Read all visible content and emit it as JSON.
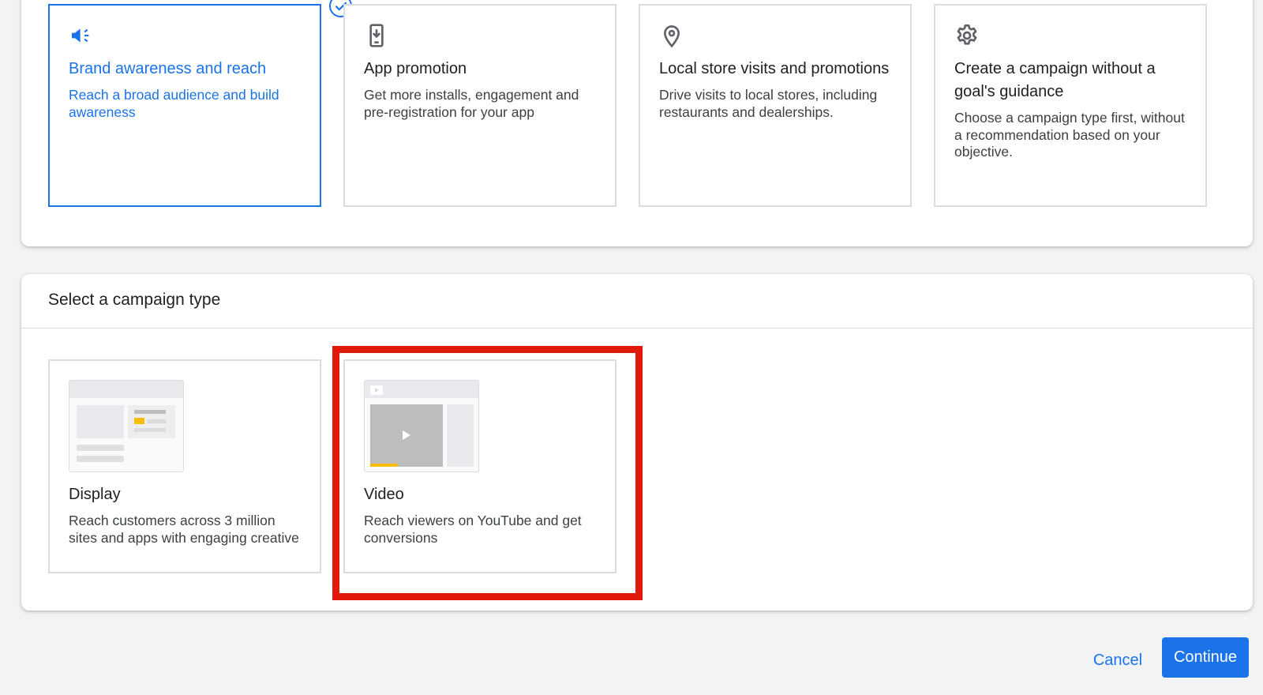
{
  "goals": [
    {
      "icon": "megaphone-icon",
      "title": "Brand awareness and reach",
      "description": "Reach a broad audience and build awareness",
      "selected": true
    },
    {
      "icon": "phone-download-icon",
      "title": "App promotion",
      "description": "Get more installs, engagement and pre-registration for your app",
      "selected": false
    },
    {
      "icon": "location-pin-icon",
      "title": "Local store visits and promotions",
      "description": "Drive visits to local stores, including restaurants and dealerships.",
      "selected": false
    },
    {
      "icon": "gear-icon",
      "title": "Create a campaign without a goal's guidance",
      "description": "Choose a campaign type first, without a recommendation based on your objective.",
      "selected": false
    }
  ],
  "campaign_type": {
    "heading": "Select a campaign type",
    "types": [
      {
        "icon": "display-ad-preview",
        "title": "Display",
        "description": "Reach customers across 3 million sites and apps with engaging creative"
      },
      {
        "icon": "video-ad-preview",
        "title": "Video",
        "description": "Reach viewers on YouTube and get conversions",
        "highlighted": true
      }
    ]
  },
  "actions": {
    "cancel_label": "Cancel",
    "continue_label": "Continue"
  },
  "colors": {
    "accent": "#1a73e8",
    "highlight": "#e0190b",
    "border": "#dadce0",
    "thumb_accent": "#fbbc04"
  }
}
